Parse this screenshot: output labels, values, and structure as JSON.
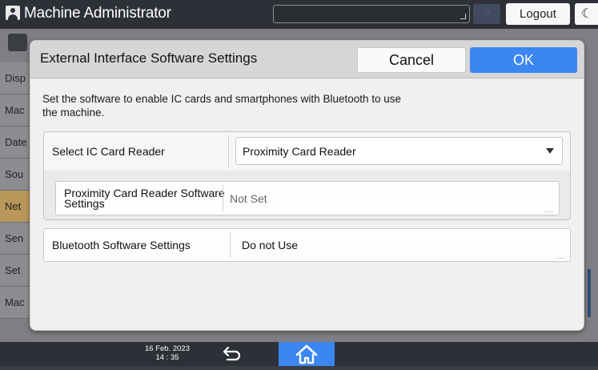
{
  "topbar": {
    "title": "Machine Administrator",
    "help_label": "?",
    "logout_label": "Logout",
    "moon_label": "☾"
  },
  "background": {
    "sidebar_items": [
      "Disp",
      "Mac",
      "Date",
      "Sou",
      "Net",
      "Sen",
      "Set",
      "Mac"
    ],
    "active_index": 4
  },
  "dialog": {
    "title": "External Interface Software Settings",
    "cancel_label": "Cancel",
    "ok_label": "OK",
    "description": "Set the software to enable IC cards and smartphones with Bluetooth to use the machine.",
    "ic_reader": {
      "label": "Select IC Card Reader",
      "value": "Proximity Card Reader"
    },
    "proximity_software": {
      "label_line1": "Proximity Card Reader Software",
      "label_line2": "Settings",
      "value": "Not Set",
      "ellipsis": "..."
    },
    "bluetooth_software": {
      "label": "Bluetooth Software Settings",
      "value": "Do not Use",
      "ellipsis": "..."
    }
  },
  "bottombar": {
    "date": "16 Feb. 2023",
    "time": "14 : 35"
  },
  "colors": {
    "accent": "#3b86f0",
    "active_sidebar": "#b9975a"
  }
}
